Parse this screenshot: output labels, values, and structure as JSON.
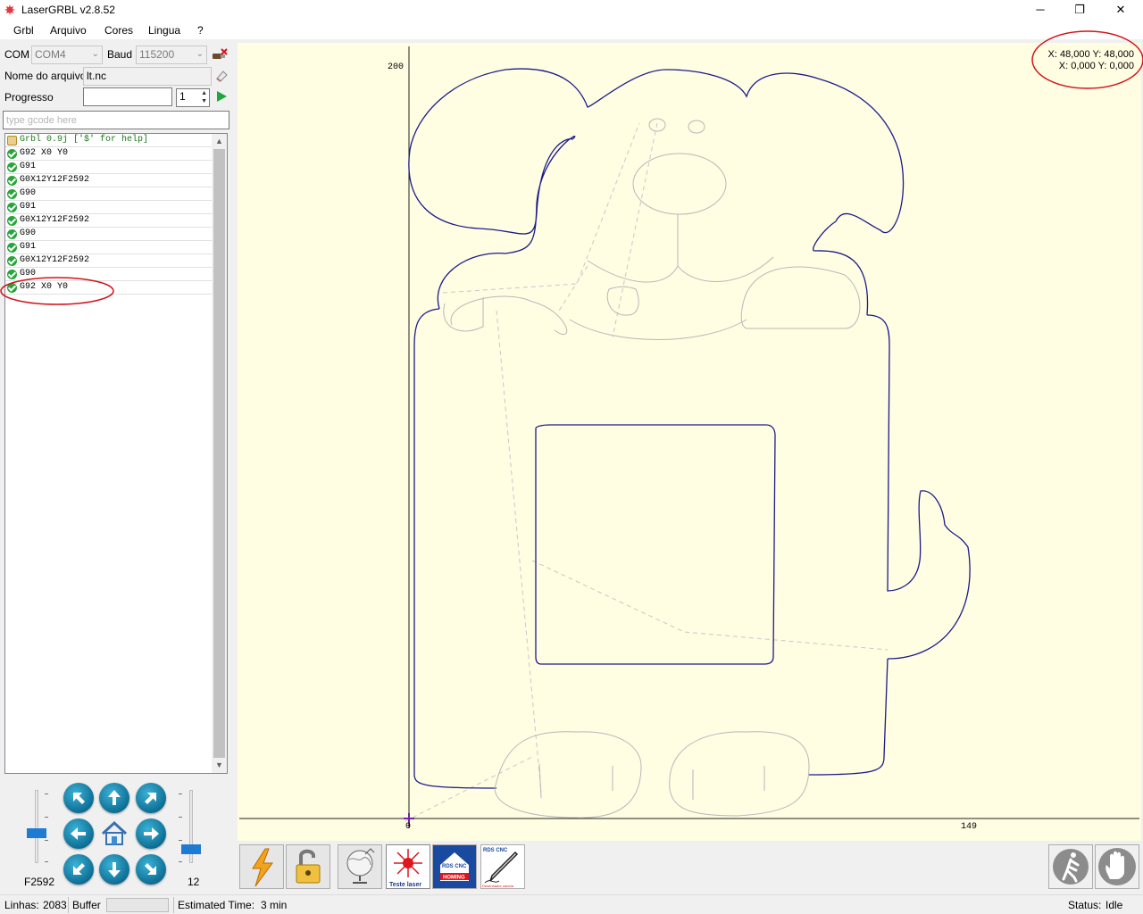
{
  "window": {
    "title": "LaserGRBL v2.8.52",
    "minimize": "─",
    "maximize": "❐",
    "close": "✕"
  },
  "menu": [
    "Grbl",
    "Arquivo",
    "Cores",
    "Lingua",
    "?"
  ],
  "connection": {
    "com_label": "COM",
    "com_value": "COM4",
    "baud_label": "Baud",
    "baud_value": "115200"
  },
  "file": {
    "label": "Nome do arquivo",
    "value": "lt.nc"
  },
  "progress": {
    "label": "Progresso",
    "value": 0,
    "copies": "1"
  },
  "gcode_input": {
    "placeholder": "type gcode here"
  },
  "log": [
    {
      "text": "Grbl 0.9j ['$' for help]",
      "status": "info"
    },
    {
      "text": "G92 X0 Y0",
      "status": "ok"
    },
    {
      "text": "G91",
      "status": "ok"
    },
    {
      "text": "G0X12Y12F2592",
      "status": "ok"
    },
    {
      "text": "G90",
      "status": "ok"
    },
    {
      "text": "G91",
      "status": "ok"
    },
    {
      "text": "G0X12Y12F2592",
      "status": "ok"
    },
    {
      "text": "G90",
      "status": "ok"
    },
    {
      "text": "G91",
      "status": "ok"
    },
    {
      "text": "G0X12Y12F2592",
      "status": "ok"
    },
    {
      "text": "G90",
      "status": "ok"
    },
    {
      "text": "G92 X0 Y0",
      "status": "ok"
    }
  ],
  "jog": {
    "speed_label": "F2592",
    "speed_value": 0.4,
    "step_label": "12",
    "step_value": 0.15,
    "buttons": [
      "up-left",
      "up",
      "up-right",
      "left",
      "home",
      "right",
      "down-left",
      "down",
      "down-right"
    ]
  },
  "preview": {
    "coords_line1": "X: 48,000 Y: 48,000",
    "coords_line2": "X: 0,000 Y: 0,000",
    "y_axis_label": "200",
    "x_axis_label": "149",
    "origin_label": "0"
  },
  "toolbar": [
    {
      "name": "lightning-icon"
    },
    {
      "name": "unlock-icon"
    },
    {
      "name": "globe-icon"
    },
    {
      "name": "test-laser-icon",
      "label": "Teste laser"
    },
    {
      "name": "homing-icon",
      "label_top": "RDS CNC",
      "label_bottom": "HOMING"
    },
    {
      "name": "pen-icon",
      "label_top": "RDS CNC",
      "label_bottom": "Desenhador caneta"
    }
  ],
  "status": {
    "lines_label": "Linhas:",
    "lines_value": "2083",
    "buffer_label": "Buffer",
    "estimated_label": "Estimated Time:",
    "estimated_value": "3 min",
    "status_label": "Status:",
    "status_value": "Idle"
  },
  "colors": {
    "preview_bg": "#fffde2",
    "path_color": "#1c1c8a",
    "travel_color": "#bdbdbd",
    "annotation_red": "#d0141b",
    "jog_blue": "#0e6f95"
  }
}
